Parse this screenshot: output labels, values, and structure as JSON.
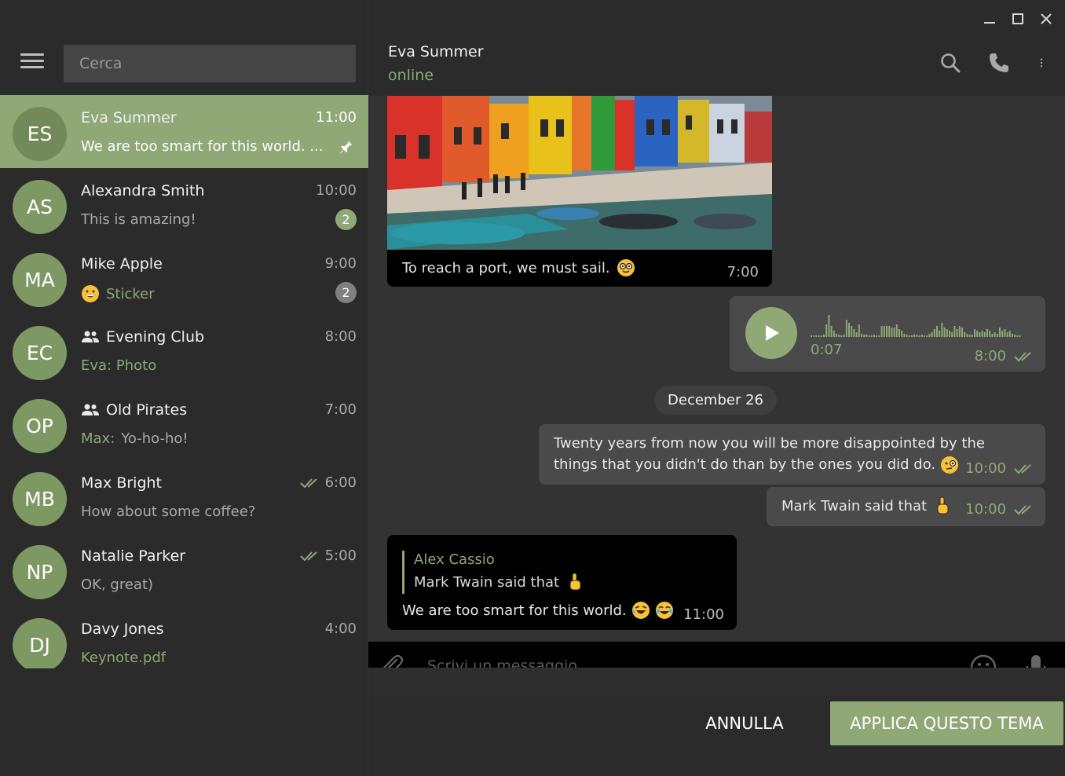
{
  "colors": {
    "accent": "#8fa876",
    "background": "#2b2b2b",
    "chat_bg": "#333333",
    "bubble_in": "#000000",
    "bubble_out": "#4a4a4a"
  },
  "search": {
    "placeholder": "Cerca"
  },
  "chats": [
    {
      "initials": "ES",
      "name": "Eva Summer",
      "time": "11:00",
      "preview": "We are too smart for this world. ...",
      "pinned": true,
      "active": true
    },
    {
      "initials": "AS",
      "name": "Alexandra Smith",
      "time": "10:00",
      "preview": "This is amazing!",
      "badge": "2"
    },
    {
      "initials": "MA",
      "name": "Mike Apple",
      "time": "9:00",
      "preview": "Sticker",
      "badge": "2"
    },
    {
      "initials": "EC",
      "name": "Evening Club",
      "time": "8:00",
      "sender": "Eva:",
      "preview": "Photo",
      "group": true
    },
    {
      "initials": "OP",
      "name": "Old Pirates",
      "time": "7:00",
      "sender": "Max:",
      "preview": "Yo-ho-ho!",
      "group": true
    },
    {
      "initials": "MB",
      "name": "Max Bright",
      "time": "6:00",
      "preview": "How about some coffee?",
      "read": true
    },
    {
      "initials": "NP",
      "name": "Natalie Parker",
      "time": "5:00",
      "preview": "OK, great)",
      "read": true
    },
    {
      "initials": "DJ",
      "name": "Davy Jones",
      "time": "4:00",
      "preview": "Keynote.pdf"
    }
  ],
  "header": {
    "name": "Eva Summer",
    "status": "online"
  },
  "messages": {
    "photo": {
      "caption": "To reach a port, we must sail.",
      "time": "7:00"
    },
    "voice": {
      "duration": "0:07",
      "time": "8:00",
      "progress": 0
    },
    "date_divider": "December 26",
    "quote": {
      "text": "Twenty years from now you will be more disappointed by the things that you didn't do than by the ones you did do.",
      "time": "10:00"
    },
    "twain": {
      "text": "Mark Twain said that",
      "time": "10:00"
    },
    "reply": {
      "author": "Alex Cassio",
      "quoted": "Mark Twain said that",
      "text": "We are too smart for this world.",
      "time": "11:00"
    }
  },
  "composer": {
    "placeholder": "Scrivi un messaggio..."
  },
  "buttons": {
    "cancel": "ANNULLA",
    "apply": "APPLICA QUESTO TEMA"
  }
}
